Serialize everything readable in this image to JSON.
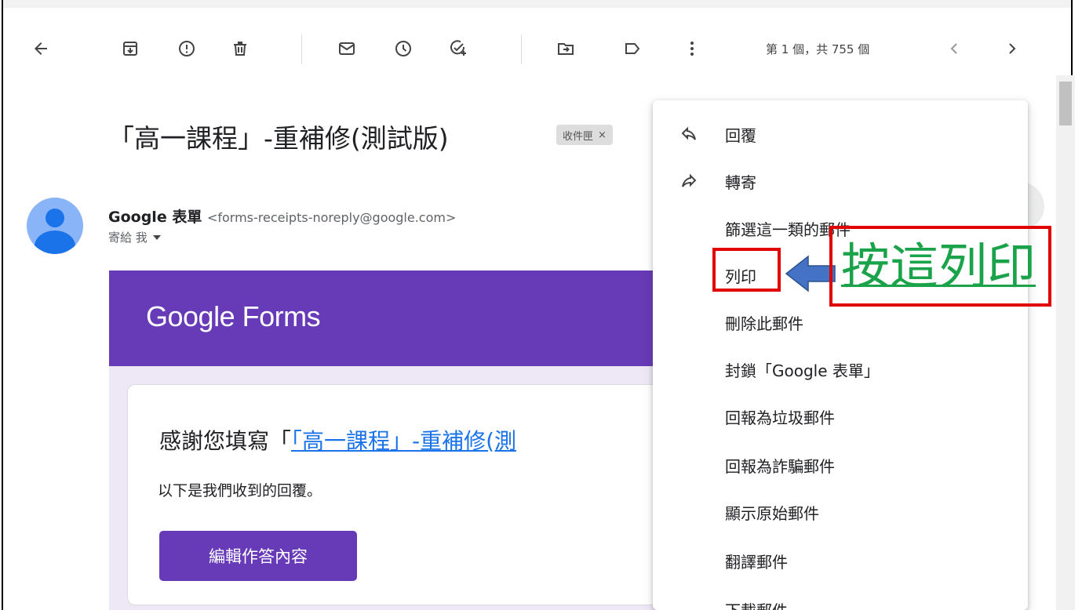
{
  "toolbar": {
    "icons": [
      "back-arrow-icon",
      "archive-icon",
      "report-spam-icon",
      "delete-icon",
      "mark-unread-icon",
      "snooze-icon",
      "add-task-icon",
      "move-to-icon",
      "label-icon",
      "more-vert-icon"
    ],
    "pager": "第 1 個，共 755 個"
  },
  "email": {
    "subject": "「高一課程」-重補修(測試版)",
    "label_chip": "收件匣",
    "sender_name": "Google 表單",
    "sender_email": "<forms-receipts-noreply@google.com>",
    "to": "寄給 我"
  },
  "body": {
    "banner_title": "Google Forms",
    "thanks_prefix": "感謝您填寫「",
    "thanks_link": "「高一課程」-重補修(測",
    "received_text": "以下是我們收到的回覆。",
    "edit_button": "編輯作答內容"
  },
  "menu": {
    "items": [
      {
        "label": "回覆",
        "icon": "reply-icon"
      },
      {
        "label": "轉寄",
        "icon": "forward-icon"
      },
      {
        "label": "篩選這一類的郵件"
      },
      {
        "label": "列印"
      },
      {
        "label": "刪除此郵件"
      },
      {
        "label": "封鎖「Google 表單」"
      },
      {
        "label": "回報為垃圾郵件"
      },
      {
        "label": "回報為詐騙郵件"
      },
      {
        "label": "顯示原始郵件"
      },
      {
        "label": "翻譯郵件"
      },
      {
        "label": "下載郵件"
      }
    ]
  },
  "annotation": {
    "note": "按這列印",
    "highlight_color": "#e00000",
    "note_color": "#1aa34a",
    "arrow_color": "#4472c4"
  }
}
